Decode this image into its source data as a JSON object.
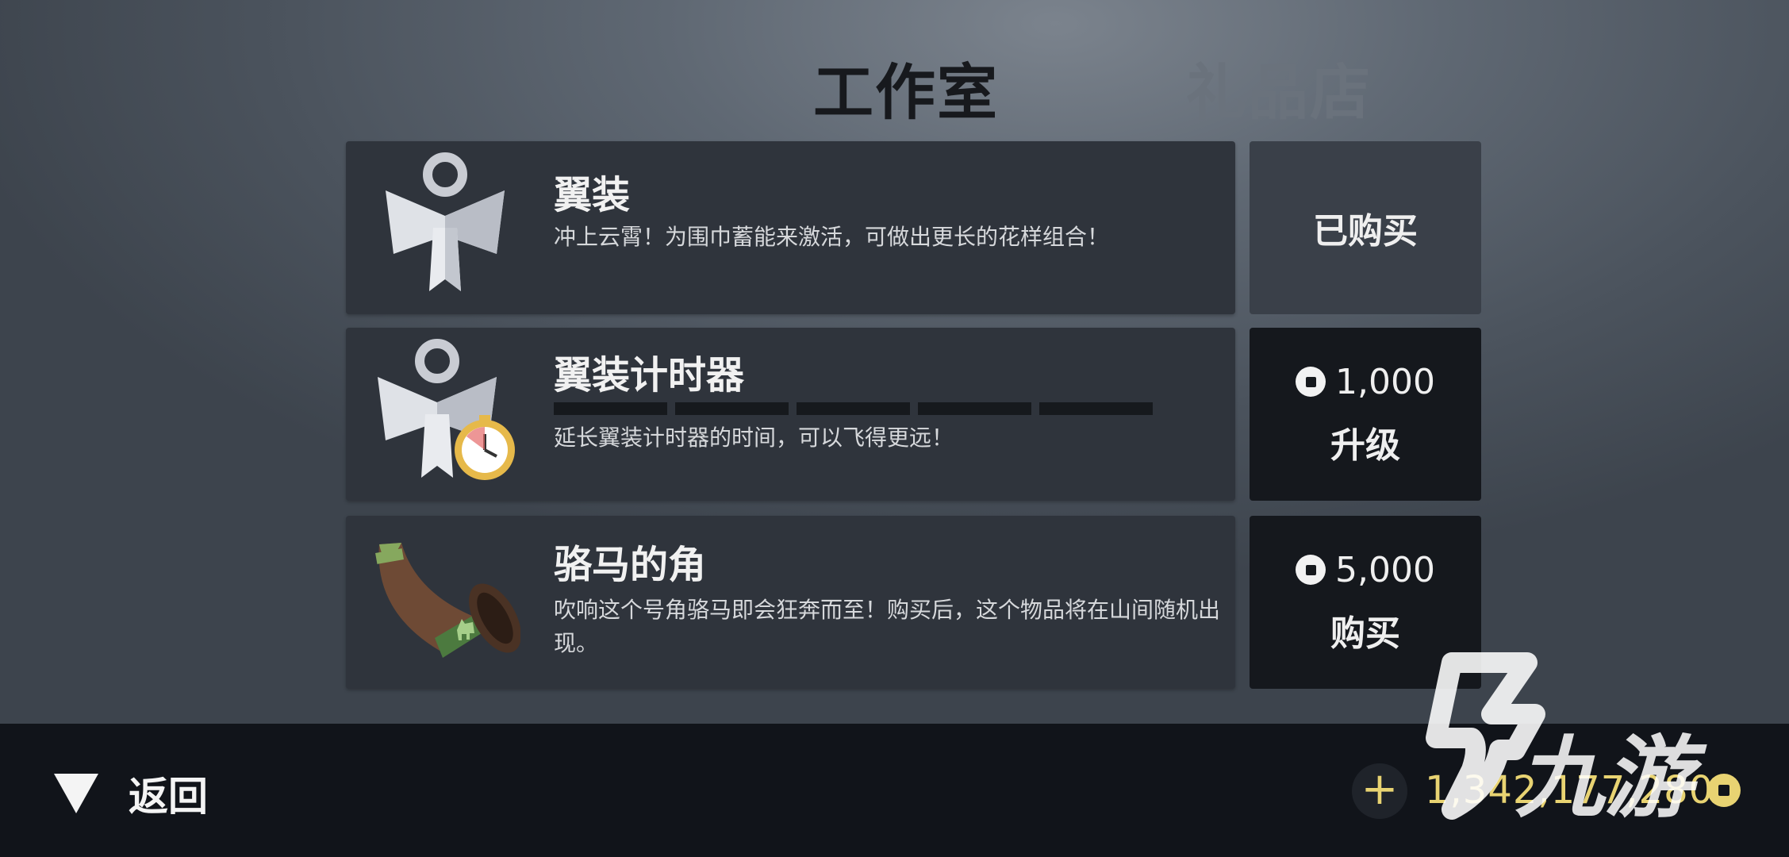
{
  "tabs": {
    "active": "工作室",
    "inactive": "礼品店"
  },
  "items": [
    {
      "title": "翼装",
      "desc": "冲上云霄！为围巾蓄能来激活，可做出更长的花样组合！",
      "action_label": "已购买",
      "icon": "wingsuit-icon"
    },
    {
      "title": "翼装计时器",
      "desc": "延长翼装计时器的时间，可以飞得更远！",
      "price": "1,000",
      "action_label": "升级",
      "icon": "wingsuit-timer-icon",
      "upgrade_progress": 0
    },
    {
      "title": "骆马的角",
      "desc": "吹响这个号角骆马即会狂奔而至！购买后，这个物品将在山间随机出现。",
      "price": "5,000",
      "action_label": "购买",
      "icon": "llama-horn-icon"
    }
  ],
  "footer": {
    "back_label": "返回",
    "add_label": "+",
    "balance": "1,342,177,280"
  },
  "watermark": {
    "text": "九游"
  },
  "colors": {
    "balance": "#e8d372",
    "card": "#2f343c",
    "buy_button": "#15181d"
  }
}
